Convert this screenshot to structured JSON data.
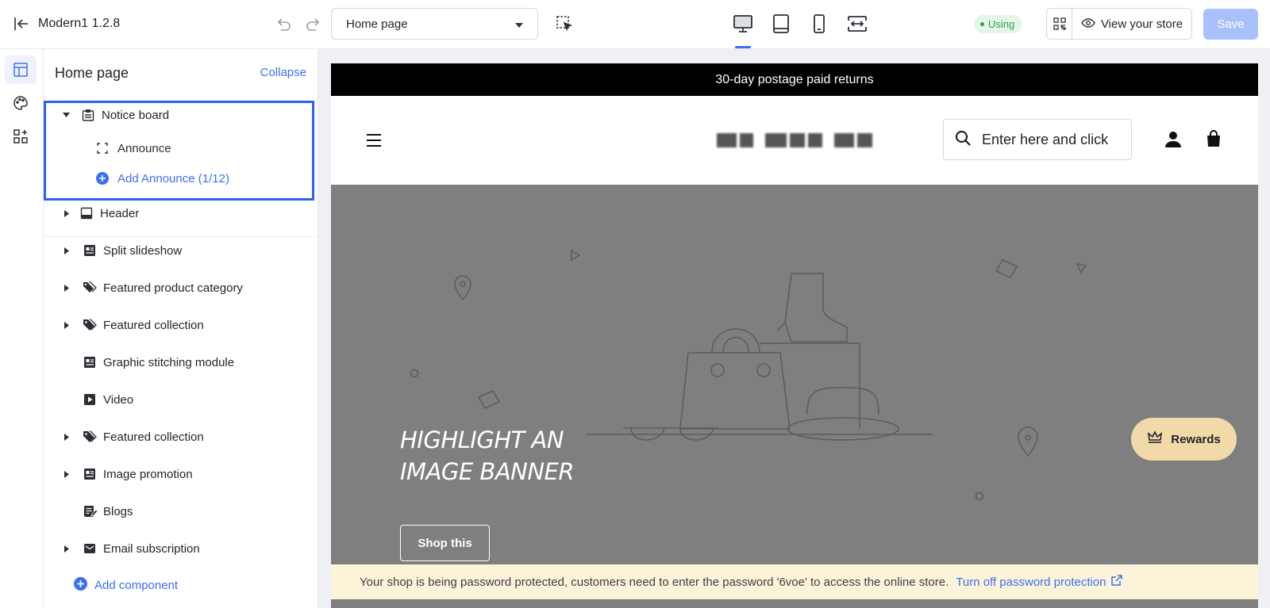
{
  "app": {
    "title": "Modern1  1.2.8"
  },
  "toolbar": {
    "page_select": "Home page",
    "using_badge": "Using",
    "view_store": "View your store",
    "save": "Save",
    "accent": "#3c6ff5"
  },
  "rail": {
    "icons": [
      "layout-icon",
      "palette-icon",
      "apps-add-icon"
    ]
  },
  "sidebar": {
    "title": "Home page",
    "collapse": "Collapse",
    "notice_board": {
      "label": "Notice board",
      "child": "Announce",
      "add": "Add Announce (1/12)"
    },
    "items": [
      {
        "label": "Header",
        "icon": "header-icon",
        "expandable": true
      },
      {
        "label": "Split slideshow",
        "icon": "slideshow-icon",
        "expandable": true
      },
      {
        "label": "Featured product category",
        "icon": "tags-icon",
        "expandable": true
      },
      {
        "label": "Featured collection",
        "icon": "tag-icon",
        "expandable": true
      },
      {
        "label": "Graphic stitching module",
        "icon": "grid-icon",
        "expandable": false
      },
      {
        "label": "Video",
        "icon": "video-icon",
        "expandable": false
      },
      {
        "label": "Featured collection",
        "icon": "tag-icon",
        "expandable": true
      },
      {
        "label": "Image promotion",
        "icon": "image-icon",
        "expandable": true
      },
      {
        "label": "Blogs",
        "icon": "blog-icon",
        "expandable": false
      },
      {
        "label": "Email subscription",
        "icon": "mail-icon",
        "expandable": true
      }
    ],
    "add_component": "Add component"
  },
  "preview": {
    "announcement": "30-day postage paid returns",
    "search_placeholder": "Enter here and click",
    "banner_heading_1": "HIGHLIGHT AN",
    "banner_heading_2": "IMAGE BANNER",
    "shop_button": "Shop this",
    "rewards": "Rewards",
    "banner_color": "#7f7f7f",
    "password_notice": "Your shop is being password protected, customers need to enter the password '6voe' to access the online store.",
    "password_link": "Turn off password protection"
  }
}
